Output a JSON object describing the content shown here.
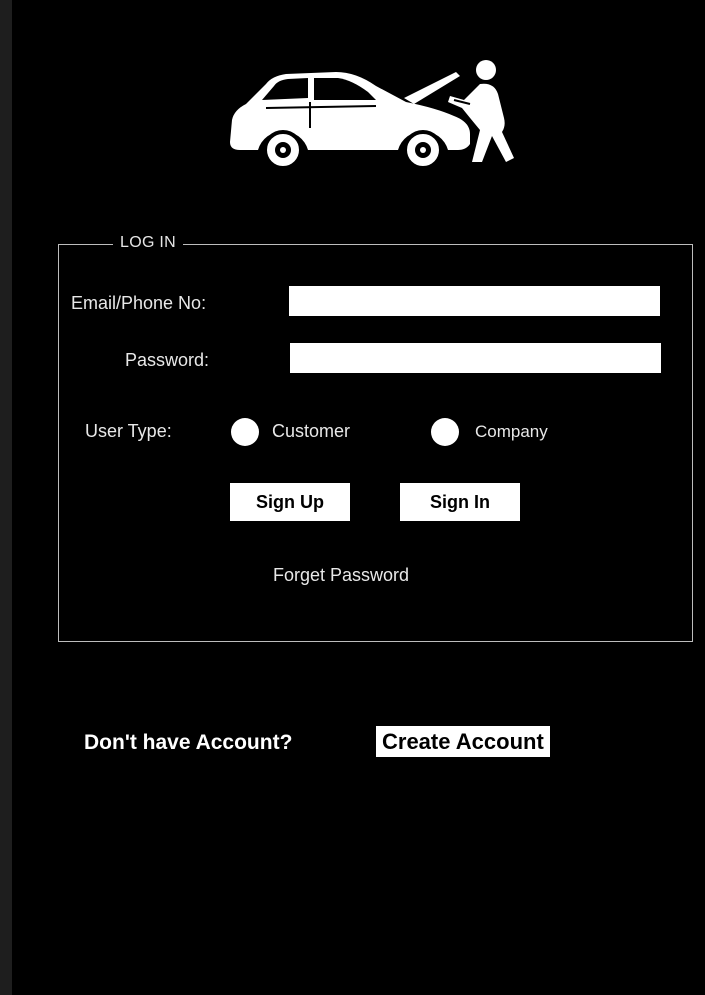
{
  "logo": {
    "icon": "car-mechanic-icon"
  },
  "login": {
    "legend": "LOG IN",
    "email_label": "Email/Phone No:",
    "email_value": "",
    "password_label": "Password:",
    "password_value": "",
    "user_type_label": "User Type:",
    "options": [
      {
        "label": "Customer",
        "selected": false
      },
      {
        "label": "Company",
        "selected": false
      }
    ],
    "signup_label": "Sign Up",
    "signin_label": "Sign In",
    "forgot_label": "Forget Password"
  },
  "footer": {
    "prompt": "Don't have Account?",
    "create_label": "Create Account"
  },
  "colors": {
    "background": "#000000",
    "foreground": "#ffffff"
  }
}
